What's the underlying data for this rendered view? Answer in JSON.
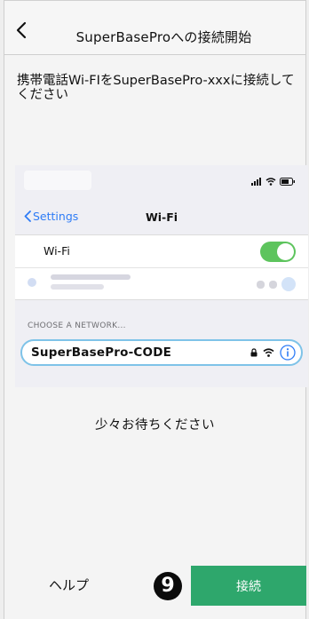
{
  "header": {
    "title": "SuperBaseProへの接続開始"
  },
  "main": {
    "instruction": "携帯電話Wi-FIをSuperBasePro-xxxに接続してください",
    "waiting_text": "少々お待ちください"
  },
  "ios_screenshot": {
    "back_label": "Settings",
    "title": "Wi-Fi",
    "wifi_toggle_label": "Wi-Fi",
    "wifi_enabled": true,
    "section_header": "CHOOSE A NETWORK...",
    "network_name": "SuperBasePro-CODE",
    "toggle_color": "#5dc45d",
    "link_color": "#2e7cf6",
    "highlight_color": "#7ec3e8"
  },
  "footer": {
    "help_label": "ヘルプ",
    "step_number": "9",
    "connect_label": "接続",
    "connect_color": "#2ea76c"
  }
}
